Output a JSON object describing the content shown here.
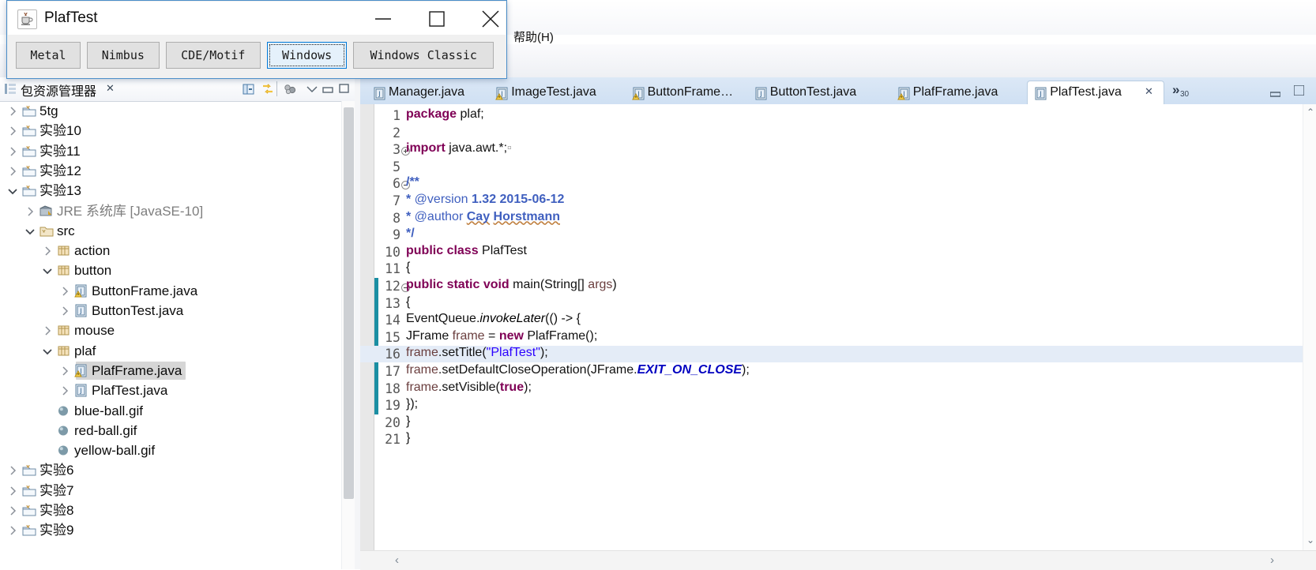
{
  "menu": {
    "help_label": "帮助(H)"
  },
  "toolbar": {
    "icons": [
      "step-into-icon",
      "dropdown-caret-icon",
      "step-return-icon",
      "dropdown-caret-icon",
      "back-arrow-icon",
      "back-arrow-icon",
      "dropdown-caret-icon",
      "forward-arrow-icon",
      "dropdown-caret-light-icon"
    ]
  },
  "package_explorer": {
    "title": "包资源管理器",
    "close_label": "✕",
    "view_icon": "package-explorer-icon",
    "toolbar_icons": [
      "collapse-all-icon",
      "link-with-editor-icon",
      "view-menu-icon",
      "minimize-icon",
      "maximize-icon"
    ],
    "tree": [
      {
        "label": "5tg",
        "indent": 0,
        "twisty": "collapsed",
        "icon": "java-project-icon",
        "selected": false,
        "dim": false
      },
      {
        "label": "实验10",
        "indent": 0,
        "twisty": "collapsed",
        "icon": "java-project-icon",
        "selected": false,
        "dim": false
      },
      {
        "label": "实验11",
        "indent": 0,
        "twisty": "collapsed",
        "icon": "java-project-icon",
        "selected": false,
        "dim": false
      },
      {
        "label": "实验12",
        "indent": 0,
        "twisty": "collapsed",
        "icon": "java-project-icon",
        "selected": false,
        "dim": false
      },
      {
        "label": "实验13",
        "indent": 0,
        "twisty": "expanded",
        "icon": "java-project-icon",
        "selected": false,
        "dim": false
      },
      {
        "label": "JRE 系统库 [JavaSE-10]",
        "indent": 1,
        "twisty": "collapsed",
        "icon": "jre-library-icon",
        "selected": false,
        "dim": true
      },
      {
        "label": "src",
        "indent": 1,
        "twisty": "expanded",
        "icon": "source-folder-icon",
        "selected": false,
        "dim": false
      },
      {
        "label": "action",
        "indent": 2,
        "twisty": "collapsed",
        "icon": "package-icon",
        "selected": false,
        "dim": false
      },
      {
        "label": "button",
        "indent": 2,
        "twisty": "expanded",
        "icon": "package-icon",
        "selected": false,
        "dim": false
      },
      {
        "label": "ButtonFrame.java",
        "indent": 3,
        "twisty": "collapsed",
        "icon": "java-file-warn-icon",
        "selected": false,
        "dim": false
      },
      {
        "label": "ButtonTest.java",
        "indent": 3,
        "twisty": "collapsed",
        "icon": "java-file-icon",
        "selected": false,
        "dim": false
      },
      {
        "label": "mouse",
        "indent": 2,
        "twisty": "collapsed",
        "icon": "package-icon",
        "selected": false,
        "dim": false
      },
      {
        "label": "plaf",
        "indent": 2,
        "twisty": "expanded",
        "icon": "package-icon",
        "selected": false,
        "dim": false
      },
      {
        "label": "PlafFrame.java",
        "indent": 3,
        "twisty": "collapsed",
        "icon": "java-file-warn-icon",
        "selected": true,
        "dim": false
      },
      {
        "label": "PlafTest.java",
        "indent": 3,
        "twisty": "collapsed",
        "icon": "java-file-icon",
        "selected": false,
        "dim": false
      },
      {
        "label": "blue-ball.gif",
        "indent": 2,
        "twisty": "none",
        "icon": "gif-file-icon",
        "selected": false,
        "dim": false
      },
      {
        "label": "red-ball.gif",
        "indent": 2,
        "twisty": "none",
        "icon": "gif-file-icon",
        "selected": false,
        "dim": false
      },
      {
        "label": "yellow-ball.gif",
        "indent": 2,
        "twisty": "none",
        "icon": "gif-file-icon",
        "selected": false,
        "dim": false
      },
      {
        "label": "实验6",
        "indent": 0,
        "twisty": "collapsed",
        "icon": "java-project-icon",
        "selected": false,
        "dim": false
      },
      {
        "label": "实验7",
        "indent": 0,
        "twisty": "collapsed",
        "icon": "java-project-icon",
        "selected": false,
        "dim": false
      },
      {
        "label": "实验8",
        "indent": 0,
        "twisty": "collapsed",
        "icon": "java-project-icon",
        "selected": false,
        "dim": false
      },
      {
        "label": "实验9",
        "indent": 0,
        "twisty": "collapsed",
        "icon": "java-project-icon",
        "selected": false,
        "dim": false
      }
    ]
  },
  "editor": {
    "tabs": [
      {
        "label": "Manager.java",
        "icon": "java-file-icon",
        "active": false,
        "closable": false
      },
      {
        "label": "ImageTest.java",
        "icon": "java-file-warn-icon",
        "active": false,
        "closable": false
      },
      {
        "label": "ButtonFrame…",
        "icon": "java-file-warn-icon",
        "active": false,
        "closable": false
      },
      {
        "label": "ButtonTest.java",
        "icon": "java-file-icon",
        "active": false,
        "closable": false
      },
      {
        "label": "PlafFrame.java",
        "icon": "java-file-warn-icon",
        "active": false,
        "closable": false
      },
      {
        "label": "PlafTest.java",
        "icon": "java-file-icon",
        "active": true,
        "closable": true
      }
    ],
    "tab_close_label": "✕",
    "overflow_label": "»",
    "overflow_count": "30",
    "minimize_icon": "minimize-icon",
    "maximize_icon": "maximize-icon",
    "highlighted_line": 16,
    "change_bar_lines": [
      12,
      19
    ],
    "scroll_up_label": "⌃",
    "scroll_down_label": "⌄",
    "hscroll_left_label": "‹",
    "hscroll_right_label": "›",
    "lines": [
      {
        "n": 1,
        "fold": "none",
        "html": "<span class='k'>package</span> plaf;"
      },
      {
        "n": 2,
        "fold": "none",
        "html": ""
      },
      {
        "n": 3,
        "fold": "collapsed",
        "html": "<span class='k'>import</span> java.awt.*;<span style='color:#9a9a9a'>▫</span>"
      },
      {
        "n": 5,
        "fold": "none",
        "html": ""
      },
      {
        "n": 6,
        "fold": "expanded",
        "html": "<span class='cmt'>/**</span>"
      },
      {
        "n": 7,
        "fold": "none",
        "html": " <span class='cmt'>* </span><span class='cm'>@version</span><span class='cmt'> 1.32 2015-06-12</span>"
      },
      {
        "n": 8,
        "fold": "none",
        "html": " <span class='cmt'>* </span><span class='cm'>@author</span><span class='cmt'> </span><span class='cmt wavy'>Cay</span><span class='cmt'> </span><span class='cmt wavy'>Horstmann</span>"
      },
      {
        "n": 9,
        "fold": "none",
        "html": " <span class='cmt'>*/</span>"
      },
      {
        "n": 10,
        "fold": "none",
        "html": "<span class='k'>public</span> <span class='k'>class</span> PlafTest"
      },
      {
        "n": 11,
        "fold": "none",
        "html": "{"
      },
      {
        "n": 12,
        "fold": "expanded",
        "html": "   <span class='k'>public</span> <span class='k'>static</span> <span class='k'>void</span> main(String[] <span class='loc'>args</span>)"
      },
      {
        "n": 13,
        "fold": "none",
        "html": "   {"
      },
      {
        "n": 14,
        "fold": "none",
        "html": "      EventQueue.<span class='mth'>invokeLater</span>(() -&gt; {"
      },
      {
        "n": 15,
        "fold": "none",
        "html": "         JFrame <span class='loc'>frame</span> = <span class='k'>new</span> PlafFrame();"
      },
      {
        "n": 16,
        "fold": "none",
        "html": "         <span class='loc'>frame</span>.setTitle(<span class='str'>\"PlafTest\"</span>);"
      },
      {
        "n": 17,
        "fold": "none",
        "html": "         <span class='loc'>frame</span>.setDefaultCloseOperation(JFrame.<span class='fld'>EXIT_ON_CLOSE</span>);"
      },
      {
        "n": 18,
        "fold": "none",
        "html": "         <span class='loc'>frame</span>.setVisible(<span class='k'>true</span>);"
      },
      {
        "n": 19,
        "fold": "none",
        "html": "      });"
      },
      {
        "n": 20,
        "fold": "none",
        "html": "   }"
      },
      {
        "n": 21,
        "fold": "none",
        "html": "}"
      }
    ]
  },
  "plaf_dialog": {
    "title": "PlafTest",
    "app_icon": "java-coffee-cup-icon",
    "window_buttons": [
      {
        "name": "minimize-button",
        "glyph": "minimize-icon"
      },
      {
        "name": "maximize-button",
        "glyph": "maximize-icon"
      },
      {
        "name": "close-button",
        "glyph": "close-icon"
      }
    ],
    "buttons": [
      {
        "label": "Metal",
        "focused": false
      },
      {
        "label": "Nimbus",
        "focused": false
      },
      {
        "label": "CDE/Motif",
        "focused": false
      },
      {
        "label": "Windows",
        "focused": true
      },
      {
        "label": "Windows Classic",
        "focused": false
      }
    ]
  },
  "colors": {
    "accent": "#0078d7",
    "tab_active_bg": "#ffffff",
    "tabstrip_bg": "#cfe0f3",
    "selection_bg": "#d6d6d6",
    "line_highlight": "#e4ecf7",
    "change_bar": "#1b8fa3",
    "keyword": "#7f0055",
    "comment": "#3f5fbf",
    "string": "#2a00ff",
    "field": "#0000c0",
    "local_var": "#6a3e3e"
  }
}
